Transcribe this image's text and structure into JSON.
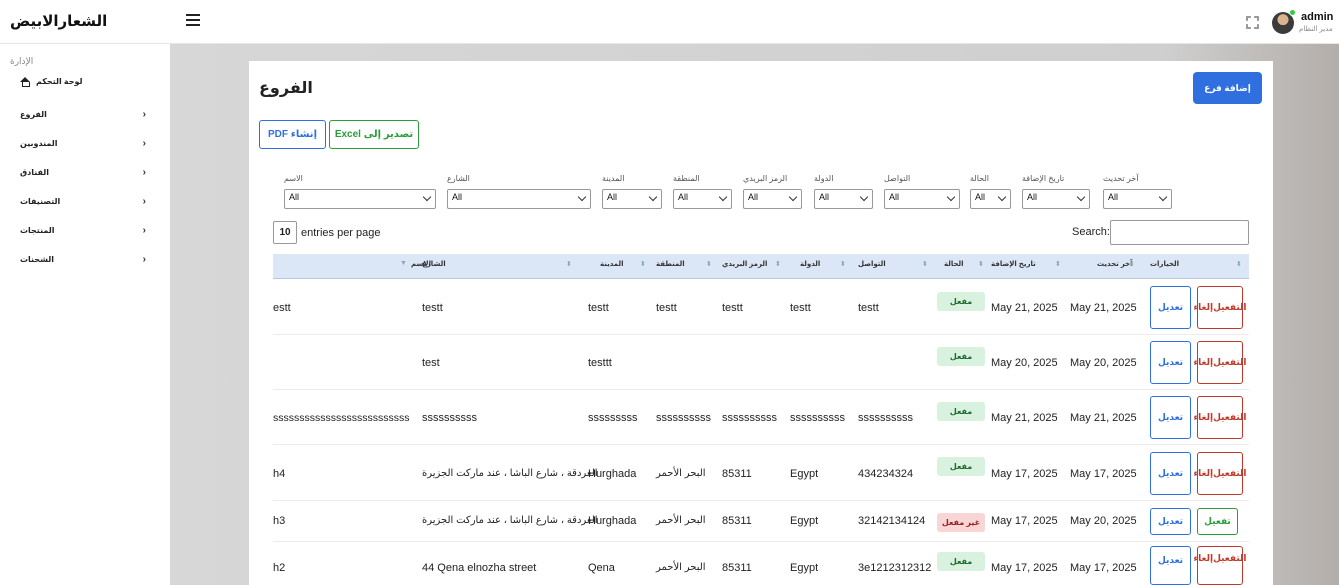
{
  "header": {
    "brand": "الشعارالابيض",
    "user_name": "admin",
    "user_role": "مدير النظام",
    "icons": [
      "menu-icon",
      "fullscreen-icon"
    ]
  },
  "sidebar": {
    "section": "الإدارة",
    "dashboard": "لوحة التحكم",
    "items": [
      {
        "label": "الفروع"
      },
      {
        "label": "المندوبين"
      },
      {
        "label": "الفنادق"
      },
      {
        "label": "التصنيفات"
      },
      {
        "label": "المنتجات"
      },
      {
        "label": "الشحنات"
      }
    ]
  },
  "page": {
    "title": "الفروع",
    "add_button": "إضافة فرع",
    "pdf_button": "PDF إنشاء",
    "excel_button": "Excel تصدير إلى"
  },
  "filters": [
    {
      "label": "الاسم",
      "value": "All"
    },
    {
      "label": "الشارع",
      "value": "All"
    },
    {
      "label": "المدينة",
      "value": "All"
    },
    {
      "label": "المنطقة",
      "value": "All"
    },
    {
      "label": "الرمز البريدي",
      "value": "All"
    },
    {
      "label": "الدولة",
      "value": "All"
    },
    {
      "label": "التواصل",
      "value": "All"
    },
    {
      "label": "الحالة",
      "value": "All"
    },
    {
      "label": "تاريخ الإضافة",
      "value": "All"
    },
    {
      "label": "آخر تحديث",
      "value": "All"
    }
  ],
  "table_controls": {
    "entries_value": "10",
    "entries_label": "entries per page",
    "search_label": "Search:"
  },
  "columns": {
    "name": "الاسم",
    "street": "الشارع",
    "city": "المدينة",
    "region": "المنطقة",
    "postal": "الرمز البريدي",
    "country": "الدولة",
    "contact": "التواصل",
    "status": "الحالة",
    "added": "تاريخ الإضافة",
    "updated": "آخر تحديث",
    "options": "الخيارات"
  },
  "actions": {
    "edit": "تعديل",
    "deactivate_1": "إلغاء",
    "deactivate_2": "التفعيل",
    "activate": "تفعيل"
  },
  "rows": [
    {
      "name": "estt",
      "street": "testt",
      "city": "testt",
      "region": "testt",
      "postal": "testt",
      "country": "testt",
      "contact": "testt",
      "status": "مفعل",
      "added": "May 21, 2025",
      "updated": "May 21, 2025"
    },
    {
      "name": "",
      "street": "test",
      "city": "testtt",
      "region": "",
      "postal": "",
      "country": "",
      "contact": "",
      "status": "مفعل",
      "added": "May 20, 2025",
      "updated": "May 20, 2025"
    },
    {
      "name": "ssssssssssssssssssssssssss",
      "street": "ssssssssss",
      "city": "sssssssss",
      "region": "ssssssssss",
      "postal": "ssssssssss",
      "country": "ssssssssss",
      "contact": "ssssssssss",
      "status": "مفعل",
      "added": "May 21, 2025",
      "updated": "May 21, 2025"
    },
    {
      "name": "h4",
      "street": "الغردقة ، شارع الباشا ، عند ماركت الجزيرة",
      "city": "Hurghada",
      "region": "البحر الأحمر",
      "postal": "85311",
      "country": "Egypt",
      "contact": "434234324",
      "status": "مفعل",
      "added": "May 17, 2025",
      "updated": "May 17, 2025"
    },
    {
      "name": "h3",
      "street": "الغردقة ، شارع الباشا ، عند ماركت الجزيرة",
      "city": "Hurghada",
      "region": "البحر الأحمر",
      "postal": "85311",
      "country": "Egypt",
      "contact": "32142134124",
      "status": "غير مفعل",
      "added": "May 17, 2025",
      "updated": "May 20, 2025"
    },
    {
      "name": "h2",
      "street": "44 Qena elnozha street",
      "city": "Qena",
      "region": "البحر الأحمر",
      "postal": "85311",
      "country": "Egypt",
      "contact": "3e1212312312",
      "status": "مفعل",
      "added": "May 17, 2025",
      "updated": "May 17, 2025"
    }
  ]
}
